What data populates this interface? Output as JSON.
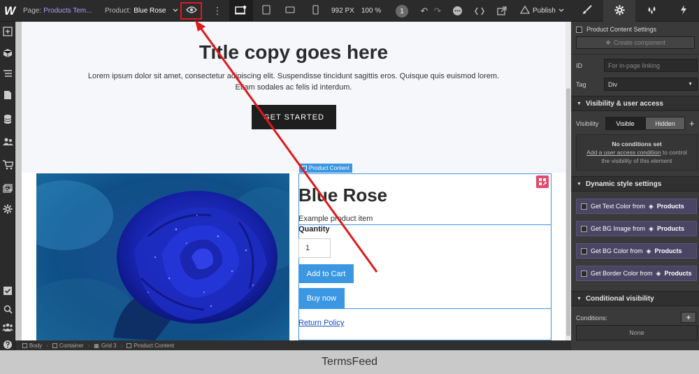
{
  "topbar": {
    "logo": "W",
    "page_label": "Page:",
    "page_value": "Products Tem...",
    "product_label": "Product:",
    "product_value": "Blue Rose",
    "canvas_width": "992 PX",
    "zoom": "100 %",
    "badge": "1",
    "publish": "Publish"
  },
  "canvas": {
    "hero_title": "Title copy goes here",
    "hero_text": "Lorem ipsum dolor sit amet, consectetur adipiscing elit. Suspendisse tincidunt sagittis eros. Quisque quis euismod lorem. Etiam sodales ac felis id interdum.",
    "cta": "GET STARTED",
    "product_badge": "Product Content",
    "product_title": "Blue Rose",
    "product_subtitle": "Example product item",
    "quantity_label": "Quantity",
    "quantity_value": "1",
    "add_to_cart": "Add to Cart",
    "buy_now": "Buy now",
    "return_policy": "Return Policy"
  },
  "breadcrumb": [
    "Body",
    "Container",
    "Grid 3",
    "Product Content"
  ],
  "panel": {
    "element_title": "Product Content Settings",
    "create_component": "Create component",
    "id_label": "ID",
    "id_placeholder": "For in-page linking",
    "tag_label": "Tag",
    "tag_value": "Div",
    "visibility_section": "Visibility & user access",
    "visibility_label": "Visibility",
    "visible": "Visible",
    "hidden": "Hidden",
    "no_conditions": "No conditions set",
    "add_condition_link": "Add a user access condition",
    "add_condition_rest_1": " to control",
    "add_condition_rest_2": "the visibility of this element",
    "dynamic_section": "Dynamic style settings",
    "dyn_items": [
      {
        "label": "Get Text Color from",
        "source": "Products"
      },
      {
        "label": "Get BG Image from",
        "source": "Products"
      },
      {
        "label": "Get BG Color from",
        "source": "Products"
      },
      {
        "label": "Get Border Color from",
        "source": "Products"
      }
    ],
    "conditional_section": "Conditional visibility",
    "conditions_label": "Conditions:",
    "conditions_none": "None"
  },
  "footer": "TermsFeed",
  "colors": {
    "accent": "#3b97e2",
    "highlight_red": "#e0191a",
    "dark_ui": "#2b2b2b"
  }
}
